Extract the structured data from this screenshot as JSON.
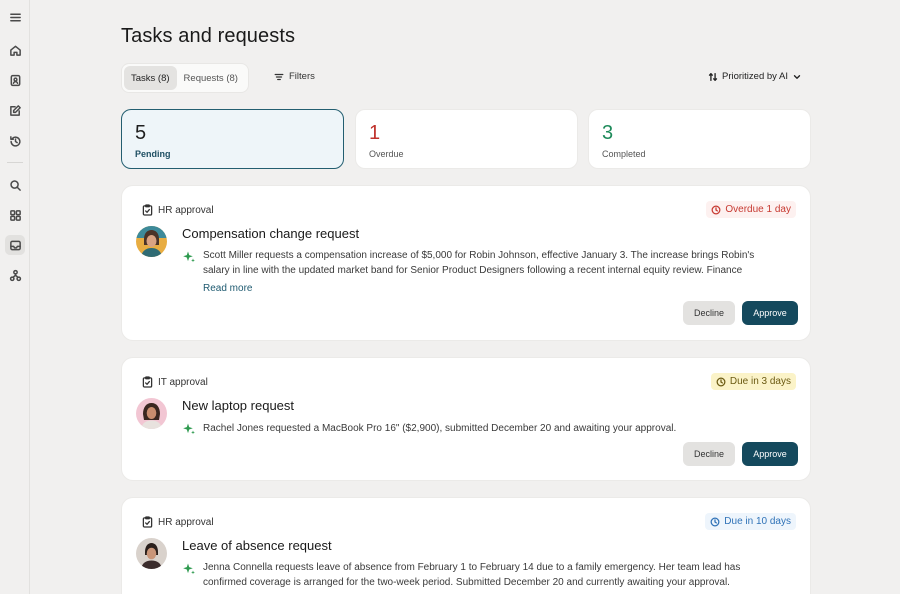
{
  "page": {
    "title": "Tasks and requests"
  },
  "tabs": [
    {
      "label": "Tasks (8)",
      "active": true
    },
    {
      "label": "Requests (8)",
      "active": false
    }
  ],
  "toolbar": {
    "filters_label": "Filters",
    "sort_label": "Prioritized by AI"
  },
  "stats": [
    {
      "value": "5",
      "label": "Pending",
      "color": "#1a1a1a"
    },
    {
      "value": "1",
      "label": "Overdue",
      "color": "#c0332d"
    },
    {
      "value": "3",
      "label": "Completed",
      "color": "#1e8a5a"
    }
  ],
  "tasks": [
    {
      "category": "HR approval",
      "badge": "Overdue 1 day",
      "title": "Compensation change request",
      "description": "Scott Miller requests a compensation increase of $5,000 for Robin Johnson, effective January 3. The increase brings Robin's salary in line with the updated market band for Senior Product Designers following a recent internal equity review. Finance",
      "read_more": "Read more",
      "decline_label": "Decline",
      "approve_label": "Approve"
    },
    {
      "category": "IT approval",
      "badge": "Due in 3 days",
      "title": "New laptop request",
      "description": "Rachel Jones requested a MacBook Pro 16\" ($2,900), submitted December 20 and awaiting your approval.",
      "decline_label": "Decline",
      "approve_label": "Approve"
    },
    {
      "category": "HR approval",
      "badge": "Due in 10 days",
      "title": "Leave of absence request",
      "description": "Jenna Connella requests leave of absence from February 1 to February 14 due to a family emergency. Her team lead has confirmed coverage is arranged for the two-week period. Submitted December 20 and currently awaiting your approval."
    }
  ],
  "colors": {
    "accent": "#14495d",
    "sparkle": "#2e9a4f"
  }
}
